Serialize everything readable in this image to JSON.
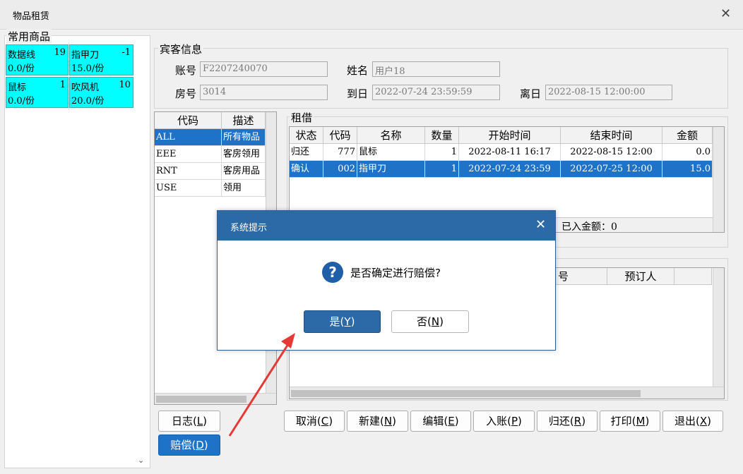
{
  "window": {
    "title": "物品租赁",
    "close": "✕"
  },
  "common": {
    "title": "常用商品",
    "items": [
      {
        "name": "数据线",
        "qty": "19",
        "price": "0.0/份"
      },
      {
        "name": "指甲刀",
        "qty": "-1",
        "price": "15.0/份"
      },
      {
        "name": "鼠标",
        "qty": "1",
        "price": "0.0/份"
      },
      {
        "name": "吹风机",
        "qty": "10",
        "price": "20.0/份"
      }
    ]
  },
  "guest": {
    "title": "宾客信息",
    "account_label": "账号",
    "account": "F2207240070",
    "name_label": "姓名",
    "name": "用户18",
    "room_label": "房号",
    "room": "3014",
    "arrive_label": "到日",
    "arrive": "2022-07-24 23:59:59",
    "depart_label": "离日",
    "depart": "2022-08-15 12:00:00"
  },
  "codes": {
    "headers": [
      "代码",
      "描述"
    ],
    "rows": [
      {
        "code": "ALL",
        "desc": "所有物品"
      },
      {
        "code": "EEE",
        "desc": "客房领用"
      },
      {
        "code": "RNT",
        "desc": "客房用品"
      },
      {
        "code": "USE",
        "desc": "领用"
      }
    ],
    "selected_row": 0
  },
  "rentals": {
    "title": "租借",
    "headers": [
      "状态",
      "代码",
      "名称",
      "数量",
      "开始时间",
      "结束时间",
      "金额"
    ],
    "rows": [
      {
        "status": "归还",
        "code": "777",
        "name": "鼠标",
        "qty": "1",
        "start": "2022-08-11 16:17",
        "end": "2022-08-15 12:00",
        "amount": "0.0"
      },
      {
        "status": "确认",
        "code": "002",
        "name": "指甲刀",
        "qty": "1",
        "start": "2022-07-24 23:59",
        "end": "2022-07-25 12:00",
        "amount": "15.0"
      }
    ],
    "selected_row": 1,
    "paid_label": "已入金额：0"
  },
  "reservations": {
    "headers_visible": [
      "号",
      "预订人"
    ]
  },
  "left_buttons": {
    "log": "日志(",
    "log_key": "L",
    "compensate": "赔偿(",
    "compensate_key": "D",
    "close_paren": ")"
  },
  "actions": [
    {
      "label": "取消(",
      "key": "C"
    },
    {
      "label": "新建(",
      "key": "N"
    },
    {
      "label": "编辑(",
      "key": "E"
    },
    {
      "label": "入账(",
      "key": "P"
    },
    {
      "label": "归还(",
      "key": "R"
    },
    {
      "label": "打印(",
      "key": "M"
    },
    {
      "label": "退出(",
      "key": "X"
    }
  ],
  "dialog": {
    "title": "系统提示",
    "close": "✕",
    "message": "是否确定进行赔偿?",
    "icon": "?",
    "yes": "是(",
    "yes_key": "Y",
    "no": "否(",
    "no_key": "N"
  },
  "colors": {
    "tile": "#00ffff",
    "selection": "#1e73c8",
    "dialog_header": "#2b6aa6",
    "arrow": "#e53935"
  }
}
